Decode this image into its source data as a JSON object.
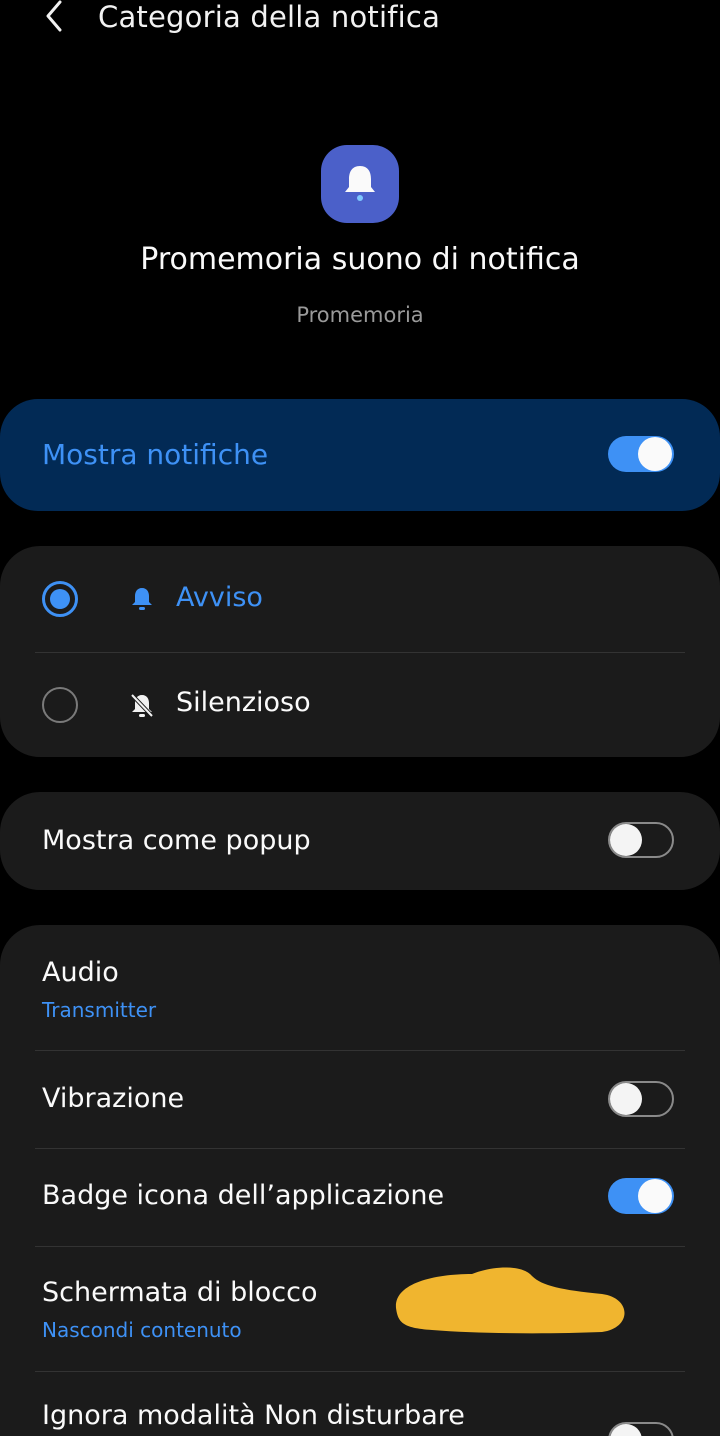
{
  "header": {
    "title": "Categoria della notifica",
    "back_icon": "chevron-left-icon"
  },
  "channel": {
    "icon": "bell-icon",
    "icon_color": "#4b60c9",
    "title": "Promemoria suono di notifica",
    "app_name": "Promemoria"
  },
  "master_switch": {
    "label": "Mostra notifiche",
    "enabled": true
  },
  "alert_mode": {
    "options": [
      {
        "label": "Avviso",
        "icon": "bell-icon",
        "selected": true
      },
      {
        "label": "Silenzioso",
        "icon": "bell-off-icon",
        "selected": false
      }
    ]
  },
  "popup": {
    "label": "Mostra come popup",
    "enabled": false
  },
  "settings": {
    "audio": {
      "label": "Audio",
      "value": "Transmitter"
    },
    "vibration": {
      "label": "Vibrazione",
      "enabled": false
    },
    "badge": {
      "label": "Badge icona dell’applicazione",
      "enabled": true
    },
    "lock_screen": {
      "label": "Schermata di blocco",
      "value": "Nascondi contenuto"
    },
    "dnd": {
      "label": "Ignora modalità Non disturbare",
      "enabled": false
    }
  },
  "colors": {
    "accent": "#3e91f5",
    "master_bg": "#022a55",
    "card_bg": "#1b1b1b",
    "redaction": "#f0b52f"
  }
}
